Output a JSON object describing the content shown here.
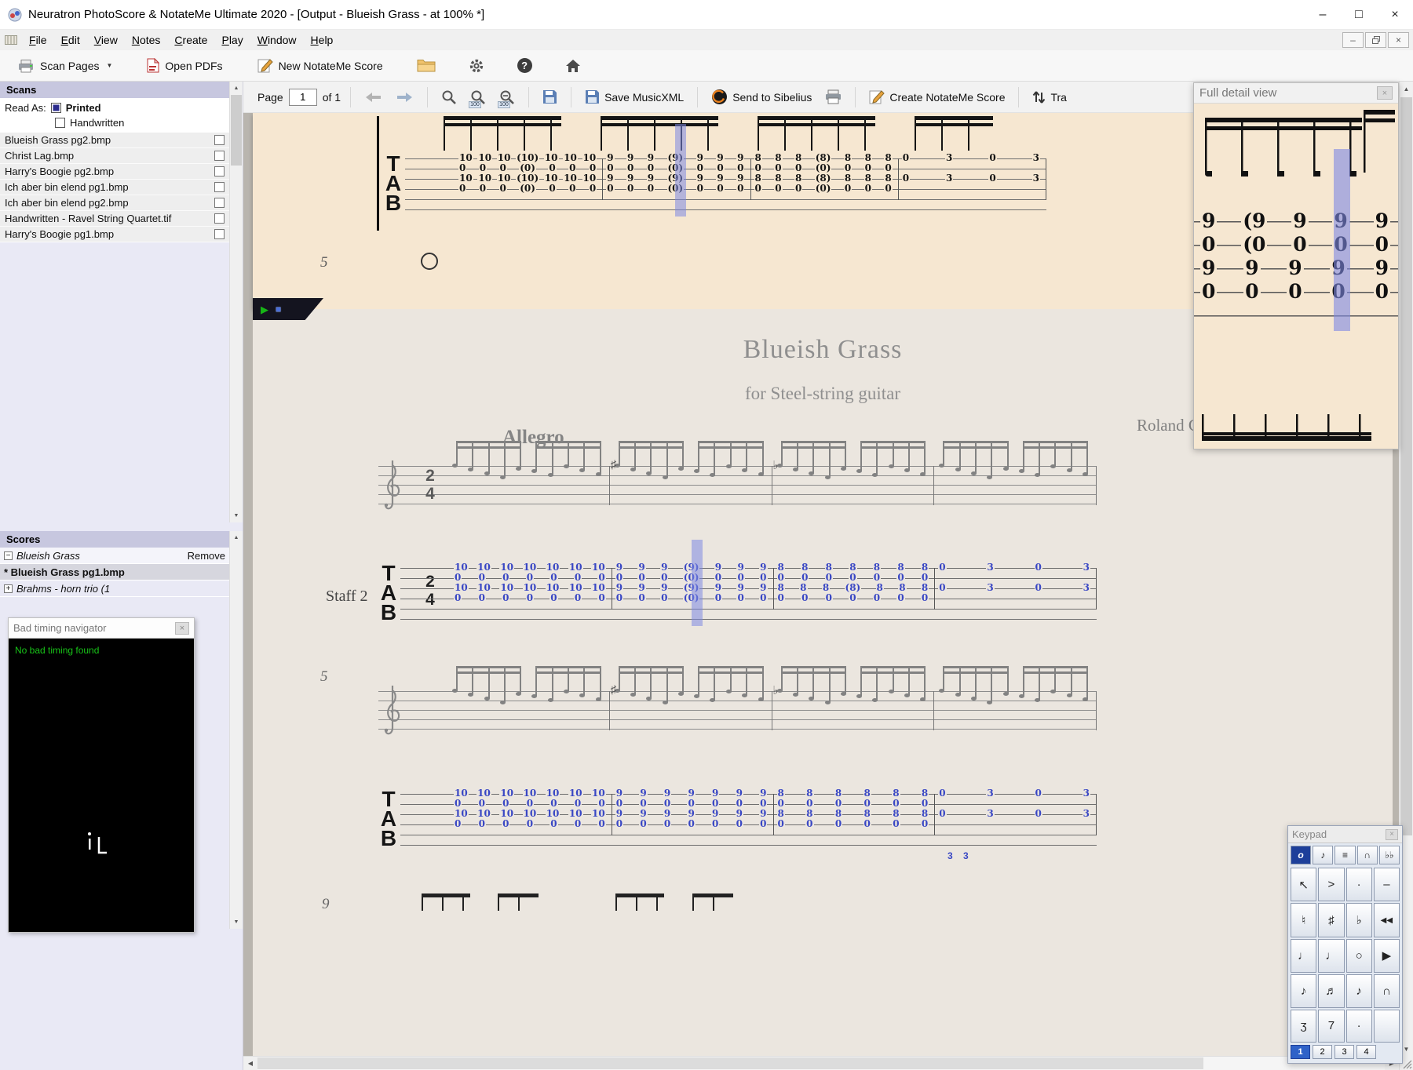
{
  "window": {
    "title": "Neuratron PhotoScore & NotateMe Ultimate 2020 - [Output - Blueish Grass - at 100% *]",
    "minimize": "–",
    "maximize": "□",
    "close": "×"
  },
  "menubar": {
    "items": [
      "File",
      "Edit",
      "View",
      "Notes",
      "Create",
      "Play",
      "Window",
      "Help"
    ]
  },
  "main_toolbar": {
    "scan_pages": "Scan Pages",
    "open_pdfs": "Open PDFs",
    "new_notateme_score": "New NotateMe Score"
  },
  "scans": {
    "header": "Scans",
    "read_as": "Read As:",
    "printed": "Printed",
    "handwritten": "Handwritten",
    "files": [
      "Blueish Grass pg2.bmp",
      "Christ Lag.bmp",
      "Harry's Boogie pg2.bmp",
      "Ich aber bin elend pg1.bmp",
      "Ich aber bin elend pg2.bmp",
      "Handwritten - Ravel String Quartet.tif",
      "Harry's Boogie pg1.bmp"
    ]
  },
  "scores": {
    "header": "Scores",
    "root": "Blueish Grass",
    "remove": "Remove",
    "selected_page": "* Blueish Grass pg1.bmp",
    "other": "Brahms - horn trio (1"
  },
  "bad_timing": {
    "title": "Bad timing navigator",
    "message": "No bad timing found"
  },
  "page_bar": {
    "page_label": "Page",
    "page_value": "1",
    "of_label": "of 1",
    "zoom_badge": "100",
    "save_musicxml": "Save MusicXML",
    "send_to_sibelius": "Send to Sibelius",
    "create_notateme_score": "Create NotateMe Score",
    "transpose_truncated": "Tra"
  },
  "full_detail": {
    "title": "Full detail view",
    "tab_rows": [
      "9 (9 9 9 9",
      "0 (0 0 0 0",
      "9 9 9 9 9",
      "0 0 0 0 0"
    ]
  },
  "keypad": {
    "title": "Keypad",
    "tabs": [
      {
        "glyph": "o",
        "name": "tab-notes",
        "selected": true
      },
      {
        "glyph": "♪",
        "name": "tab-beams",
        "selected": false
      },
      {
        "glyph": "≡",
        "name": "tab-barlines",
        "selected": false
      },
      {
        "glyph": "∩",
        "name": "tab-slurs",
        "selected": false
      },
      {
        "glyph": "♭♭",
        "name": "tab-accidentals",
        "selected": false
      }
    ],
    "buttons": [
      {
        "glyph": "↖",
        "name": "pointer-button"
      },
      {
        "glyph": ">",
        "name": "accent-button"
      },
      {
        "glyph": "·",
        "name": "staccato-button"
      },
      {
        "glyph": "–",
        "name": "tenuto-button"
      },
      {
        "glyph": "♮",
        "name": "natural-button"
      },
      {
        "glyph": "♯",
        "name": "sharp-button"
      },
      {
        "glyph": "♭",
        "name": "flat-button"
      },
      {
        "glyph": "◀◀",
        "name": "rewind-button"
      },
      {
        "glyph": "♩",
        "name": "quarter-note-button"
      },
      {
        "glyph": "♩",
        "name": "crotchet-button"
      },
      {
        "glyph": "○",
        "name": "whole-note-button"
      },
      {
        "glyph": "▶",
        "name": "play-button"
      },
      {
        "glyph": "♪",
        "name": "eighth-note-button"
      },
      {
        "glyph": "♬",
        "name": "sixteenth-note-button"
      },
      {
        "glyph": "♪",
        "name": "quaver-button"
      },
      {
        "glyph": "∩",
        "name": "tie-button"
      },
      {
        "glyph": "ʒ",
        "name": "quarter-rest-button"
      },
      {
        "glyph": "7",
        "name": "eighth-rest-button"
      },
      {
        "glyph": "·",
        "name": "dot-button"
      },
      {
        "glyph": "",
        "name": "blank-button"
      }
    ],
    "voices": [
      {
        "glyph": "1",
        "selected": true
      },
      {
        "glyph": "2",
        "selected": false
      },
      {
        "glyph": "3",
        "selected": false
      },
      {
        "glyph": "4",
        "selected": false
      }
    ]
  },
  "score": {
    "title": "Blueish Grass",
    "subtitle": "for Steel-string guitar",
    "composer": "Roland Chadwick",
    "tempo": "Allegro",
    "staff_label": "Staff 2",
    "tab_letters": [
      "T",
      "A",
      "B"
    ],
    "time_sig_top": "2",
    "time_sig_bottom": "4",
    "measure_5": "5",
    "measure_9": "9",
    "system2_extra": "3    3",
    "system1": [
      {
        "tab": [
          "10 10 10 10 10 10 10",
          "0 0 0 0 0 0 0",
          "10 10 10 10 10 10 10",
          "0 0 0 0 0 0 0"
        ]
      },
      {
        "accidental": "♯",
        "highlight_col": 3,
        "tab": [
          "9 9 9 (9) 9 9 9",
          "0 0 0 (0) 0 0 0",
          "9 9 9 (9) 9 9 9",
          "0 0 0 (0) 0 0 0"
        ]
      },
      {
        "accidental": "♭",
        "tab": [
          "8 8 8 8 8 8 8",
          "0 0 0 0 0 0 0",
          "8 8 8 (8) 8 8 8",
          "0 0 0 0 0 0 0"
        ]
      },
      {
        "tab": [
          "0 3 0 3",
          "",
          "0 3 0 3",
          ""
        ]
      }
    ],
    "system2": [
      {
        "tab": [
          "10 10 10 10 10 10 10",
          "0 0 0 0 0 0 0",
          "10 10 10 10 10 10 10",
          "0 0 0 0 0 0 0"
        ]
      },
      {
        "accidental": "♯",
        "tab": [
          "9 9 9 9 9 9 9",
          "0 0 0 0 0 0 0",
          "9 9 9 9 9 9 9",
          "0 0 0 0 0 0 0"
        ]
      },
      {
        "accidental": "♭",
        "tab": [
          "8 8 8 8 8 8",
          "0 0 0 0 0 0",
          "8 8 8 8 8 8",
          "0 0 0 0 0 0"
        ]
      },
      {
        "tab": [
          "0 3 0 3",
          "",
          "0 3 0 3",
          ""
        ]
      }
    ]
  },
  "prev_page": {
    "measure_mark": "5",
    "measures": [
      {
        "tab": [
          "10 10 10 (10) 10 10 10",
          "0 0 0 (0) 0 0 0",
          "10 10 10 (10) 10 10 10",
          "0 0 0 (0) 0 0 0"
        ]
      },
      {
        "highlight_col": 3,
        "tab": [
          "9 9 9 (9) 9 9 9",
          "0 0 0 (0) 0 0 0",
          "9 9 9 (9) 9 9 9",
          "0 0 0 (0) 0 0 0"
        ]
      },
      {
        "tab": [
          "8 8 8 (8) 8 8 8",
          "0 0 0 (0) 0 0 0",
          "8 8 8 (8) 8 8 8",
          "0 0 0 (0) 0 0 0"
        ]
      },
      {
        "tab": [
          "0 3 0 3",
          "",
          "0 3 0 3",
          ""
        ]
      }
    ]
  },
  "colors": {
    "tab_number_blue": "#3947c4",
    "highlight": "#7e88e2",
    "page_beige": "#f6e7d1",
    "page_main": "#ebe6df",
    "selected_blue": "#2f62c8"
  }
}
